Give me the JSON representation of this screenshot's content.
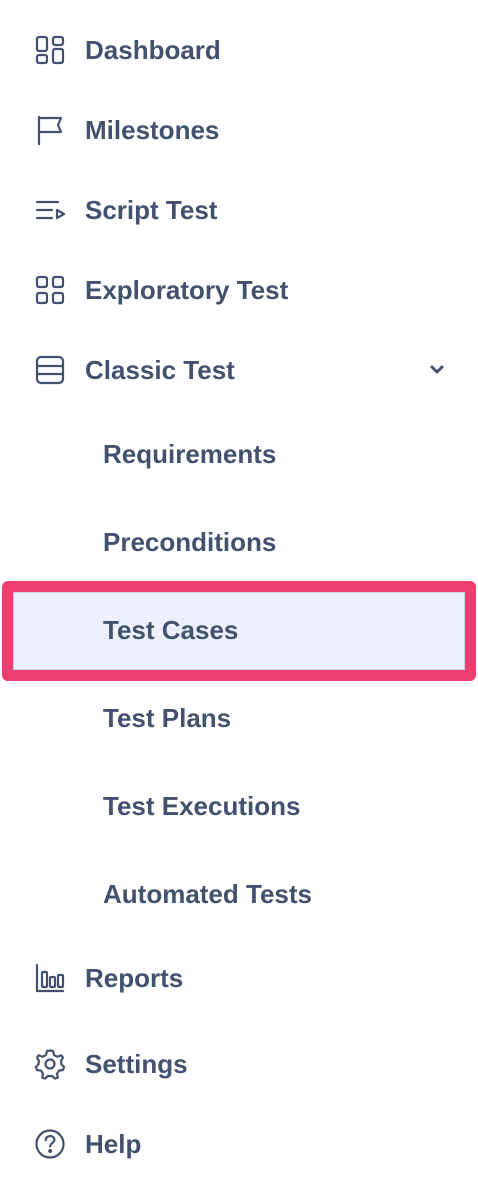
{
  "nav": {
    "items": [
      {
        "label": "Dashboard",
        "icon": "dashboard-icon"
      },
      {
        "label": "Milestones",
        "icon": "flag-icon"
      },
      {
        "label": "Script Test",
        "icon": "script-list-icon"
      },
      {
        "label": "Exploratory Test",
        "icon": "grid-icon"
      },
      {
        "label": "Classic Test",
        "icon": "table-icon",
        "expanded": true
      }
    ],
    "classic_sub": [
      {
        "label": "Requirements"
      },
      {
        "label": "Preconditions"
      },
      {
        "label": "Test Cases",
        "selected": true
      },
      {
        "label": "Test Plans"
      },
      {
        "label": "Test Executions"
      },
      {
        "label": "Automated Tests"
      }
    ],
    "bottom": [
      {
        "label": "Reports",
        "icon": "bar-chart-icon"
      },
      {
        "label": "Settings",
        "icon": "gear-icon"
      },
      {
        "label": "Help",
        "icon": "help-icon"
      }
    ]
  },
  "colors": {
    "text": "#42526e",
    "selected_bg": "#ebf0fc",
    "highlight_border": "#ec3e6f"
  }
}
